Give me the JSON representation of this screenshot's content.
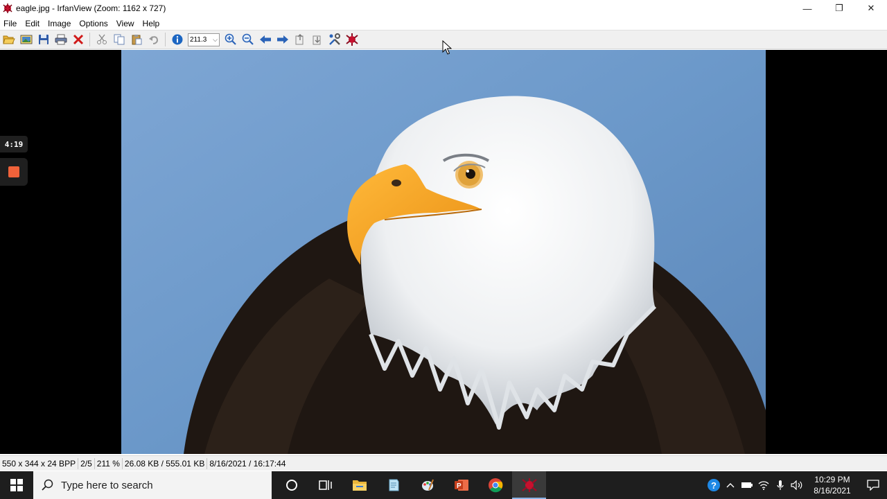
{
  "window": {
    "title": "eagle.jpg - IrfanView (Zoom: 1162 x 727)",
    "minimize": "—",
    "restore": "❐",
    "close": "✕"
  },
  "menu": [
    "File",
    "Edit",
    "Image",
    "Options",
    "View",
    "Help"
  ],
  "toolbar": {
    "zoom_value": "211.3",
    "icons": [
      "open-icon",
      "slideshow-icon",
      "save-icon",
      "print-icon",
      "delete-icon",
      "cut-icon",
      "copy-icon",
      "paste-icon",
      "undo-icon",
      "info-icon",
      "zoom-in-icon",
      "zoom-out-icon",
      "previous-icon",
      "next-icon",
      "copy-to-icon",
      "move-to-icon",
      "settings-icon",
      "about-icon"
    ]
  },
  "recorder": {
    "elapsed": "4:19"
  },
  "status": {
    "dimensions": "550 x 344 x 24 BPP",
    "index": "2/5",
    "zoom": "211 %",
    "size": "26.08 KB / 555.01 KB",
    "datetime": "8/16/2021 / 16:17:44"
  },
  "taskbar": {
    "search_placeholder": "Type here to search",
    "apps": [
      "cortana-icon",
      "task-view-icon",
      "file-explorer-icon",
      "notepad-icon",
      "paint-icon",
      "powerpoint-icon",
      "chrome-icon",
      "irfanview-icon"
    ],
    "time": "10:29 PM",
    "date": "8/16/2021"
  },
  "colors": {
    "sky": "#6b98c9",
    "toolbar_bg": "#f0f0f0",
    "taskbar_bg": "#1e1e1e",
    "recorder_stop": "#f0623a"
  }
}
